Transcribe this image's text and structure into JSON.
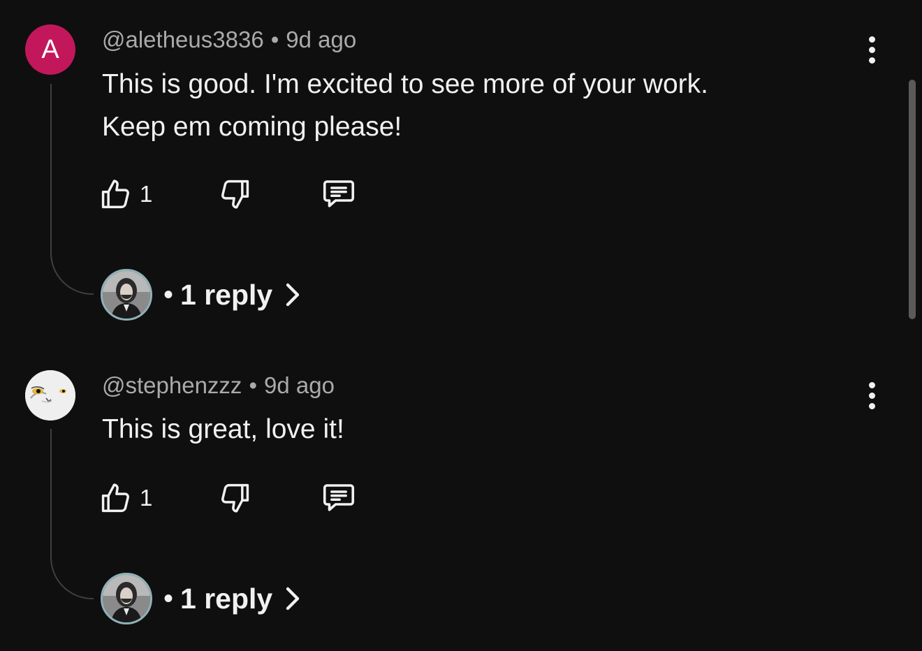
{
  "comments": [
    {
      "avatar_letter": "A",
      "avatar_color": "#c2185b",
      "handle": "@aletheus3836",
      "separator": "•",
      "time": "9d ago",
      "text_line1": "This is good. I'm excited to see more of your work.",
      "text_line2": "Keep em coming please!",
      "like_count": "1",
      "replies_separator": "•",
      "replies_label": "1 reply",
      "icons": {
        "like": "thumbs-up-icon",
        "dislike": "thumbs-down-icon",
        "reply": "comment-icon",
        "more": "more-vertical-icon",
        "expand": "chevron-right-icon"
      }
    },
    {
      "avatar_letter": "",
      "avatar_color": "#eeeeee",
      "handle": "@stephenzzz",
      "separator": "•",
      "time": "9d ago",
      "text_line1": "This is great, love it!",
      "text_line2": "",
      "like_count": "1",
      "replies_separator": "•",
      "replies_label": "1 reply",
      "icons": {
        "like": "thumbs-up-icon",
        "dislike": "thumbs-down-icon",
        "reply": "comment-icon",
        "more": "more-vertical-icon",
        "expand": "chevron-right-icon"
      }
    }
  ],
  "theme": {
    "background": "#0f0f0f",
    "text": "#f1f1f1",
    "muted": "#aaaaaa"
  }
}
